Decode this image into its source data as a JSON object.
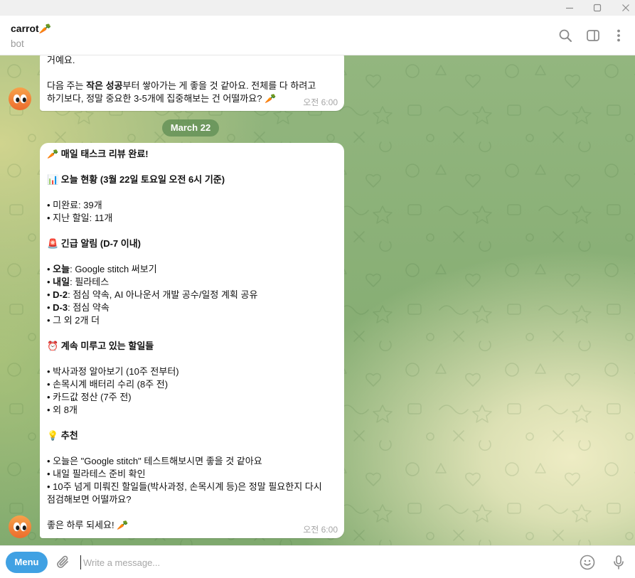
{
  "window": {
    "controls": {
      "minimize": "minimize-icon",
      "maximize": "maximize-icon",
      "close": "close-icon"
    }
  },
  "header": {
    "title": "carrot🥕",
    "subtitle": "bot",
    "actions": {
      "search": "search-icon",
      "sidebar": "sidebar-toggle-icon",
      "more": "more-vertical-icon"
    }
  },
  "chat": {
    "date_separator": "March 22",
    "messages": [
      {
        "lines": [
          [
            {
              "text": "거예요."
            }
          ],
          [],
          [
            {
              "text": "다음 주는 "
            },
            {
              "text": "작은 성공",
              "bold": true
            },
            {
              "text": "부터 쌓아가는 게 좋을 것 같아요. 전체를 다 하려고"
            }
          ],
          [
            {
              "text": "하기보다, 정말 중요한 3-5개에 집중해보는 건 어떨까요? 🥕"
            }
          ]
        ],
        "time": "오전 6:00"
      },
      {
        "lines": [
          [
            {
              "text": "🥕 매일 태스크 리뷰 완료!",
              "bold": true
            }
          ],
          [],
          [
            {
              "text": "📊 오늘 현황 (3월 22일 토요일 오전 6시 기준)",
              "bold": true
            }
          ],
          [],
          [
            {
              "text": "• 미완료: 39개"
            }
          ],
          [
            {
              "text": "• 지난 할일: 11개"
            }
          ],
          [],
          [
            {
              "text": "🚨 긴급 알림 (D-7 이내)",
              "bold": true
            }
          ],
          [],
          [
            {
              "text": "• "
            },
            {
              "text": "오늘",
              "bold": true
            },
            {
              "text": ": Google stitch 써보기"
            }
          ],
          [
            {
              "text": "• "
            },
            {
              "text": "내일",
              "bold": true
            },
            {
              "text": ": 필라테스"
            }
          ],
          [
            {
              "text": "• "
            },
            {
              "text": "D-2",
              "bold": true
            },
            {
              "text": ": 점심 약속, AI 아나운서 개발 공수/일정 계획 공유"
            }
          ],
          [
            {
              "text": "• "
            },
            {
              "text": "D-3",
              "bold": true
            },
            {
              "text": ": 점심 약속"
            }
          ],
          [
            {
              "text": "• 그 외 2개 더"
            }
          ],
          [],
          [
            {
              "text": "⏰ 계속 미루고 있는 할일들",
              "bold": true
            }
          ],
          [],
          [
            {
              "text": "• 박사과정 알아보기 (10주 전부터)"
            }
          ],
          [
            {
              "text": "• 손목시계 배터리 수리 (8주 전)"
            }
          ],
          [
            {
              "text": "• 카드값 정산 (7주 전)"
            }
          ],
          [
            {
              "text": "• 외 8개"
            }
          ],
          [],
          [
            {
              "text": "💡 추천",
              "bold": true
            }
          ],
          [],
          [
            {
              "text": "• 오늘은 \"Google stitch\" 테스트해보시면 좋을 것 같아요"
            }
          ],
          [
            {
              "text": "• 내일 필라테스 준비 확인"
            }
          ],
          [
            {
              "text": "• 10주 넘게 미뤄진 할일들(박사과정, 손목시계 등)은 정말 필요한지 다시"
            }
          ],
          [
            {
              "text": "점검해보면 어떨까요?"
            }
          ],
          [],
          [
            {
              "text": "좋은 하루 되세요! 🥕"
            }
          ]
        ],
        "time": "오전 6:00"
      }
    ]
  },
  "composer": {
    "menu_label": "Menu",
    "placeholder": "Write a message...",
    "icons": {
      "attach": "paperclip-icon",
      "emoji": "smiley-icon",
      "voice": "microphone-icon"
    }
  },
  "colors": {
    "accent": "#40a1e3",
    "bubble": "#ffffff",
    "date_pill": "#608e54",
    "time_text": "#a6a6a6",
    "icon": "#8a8a8a",
    "avatar": "#f0803a"
  }
}
